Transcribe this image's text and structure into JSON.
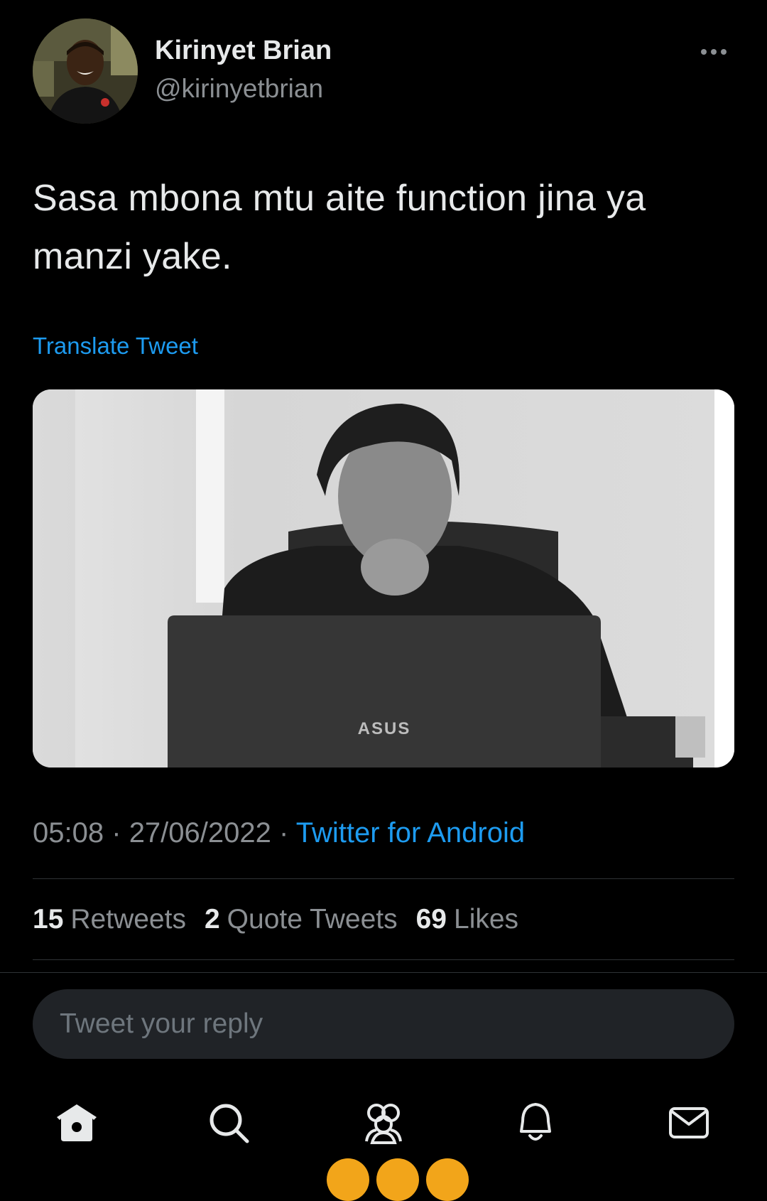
{
  "tweet": {
    "author": {
      "name": "Kirinyet Brian",
      "handle": "@kirinyetbrian"
    },
    "text": "Sasa mbona mtu aite function jina ya manzi yake.",
    "translate_label": "Translate Tweet",
    "time": "05:08",
    "date": "27/06/2022",
    "separator": "·",
    "source": "Twitter for Android",
    "media": {
      "brand_text": "ASUS"
    },
    "stats": {
      "retweets_count": "15",
      "retweets_label": "Retweets",
      "quotes_count": "2",
      "quotes_label": "Quote Tweets",
      "likes_count": "69",
      "likes_label": "Likes"
    }
  },
  "reply": {
    "placeholder": "Tweet your reply"
  },
  "nav": {
    "items": [
      "home-icon",
      "search-icon",
      "communities-icon",
      "notifications-icon",
      "messages-icon"
    ]
  },
  "colors": {
    "background": "#000000",
    "text": "#e7e9ea",
    "secondary_text": "#8b8f93",
    "accent": "#1d9bf0",
    "reply_box": "#202327"
  }
}
